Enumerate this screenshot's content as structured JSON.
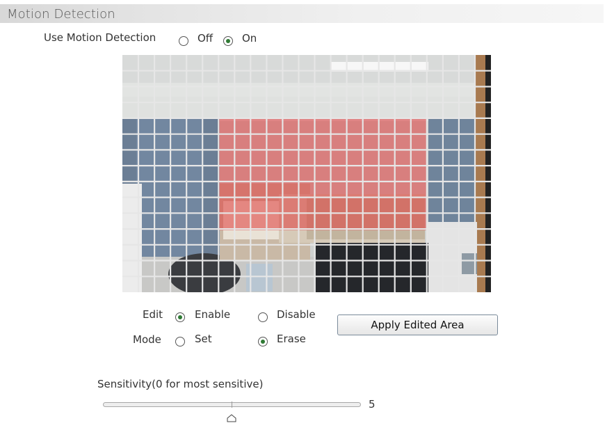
{
  "section": {
    "title": "Motion Detection"
  },
  "use_motion": {
    "label": "Use Motion Detection",
    "options": [
      "Off",
      "On"
    ],
    "selected": "On"
  },
  "edit": {
    "label": "Edit",
    "options": [
      "Enable",
      "Disable"
    ],
    "selected": "Enable"
  },
  "mode": {
    "label": "Mode",
    "options": [
      "Set",
      "Erase"
    ],
    "selected": "Erase"
  },
  "apply_button": {
    "label": "Apply Edited Area"
  },
  "sensitivity": {
    "label": "Sensitivity(0 for most sensitive)",
    "value": "5"
  },
  "colors": {
    "grid_line": "#e6e6e6",
    "selected_area": "#e03c3c",
    "radio_dot": "#2f7a34"
  }
}
